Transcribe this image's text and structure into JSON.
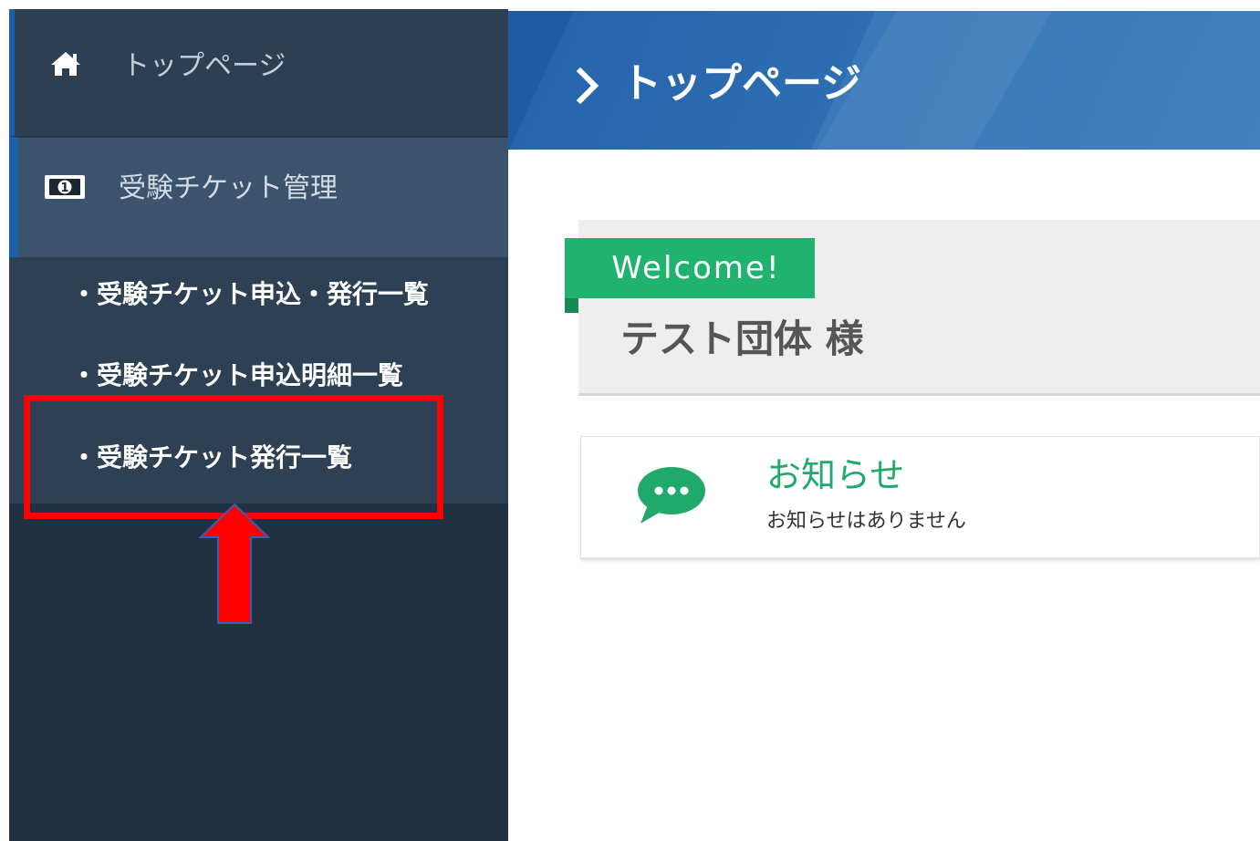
{
  "sidebar": {
    "home": {
      "label": "トップページ",
      "icon": "home-icon"
    },
    "group": {
      "label": "受験チケット管理",
      "icon": "ticket-icon"
    },
    "items": [
      {
        "label": "・受験チケット申込・発行一覧"
      },
      {
        "label": "・受験チケット申込明細一覧"
      },
      {
        "label": "・受験チケット発行一覧"
      }
    ]
  },
  "header": {
    "title": "トップページ",
    "icon": "chevron-right-icon"
  },
  "welcome": {
    "badge": "Welcome!",
    "name": "テスト団体 様"
  },
  "notice": {
    "icon": "chat-bubble-icon",
    "title": "お知らせ",
    "body": "お知らせはありません"
  },
  "annotation": {
    "box_color": "#ff0000",
    "arrow_color": "#ff0000"
  },
  "colors": {
    "sidebar_bg": "#223142",
    "header_blue": "#2d6db1",
    "accent_green": "#20b36f"
  }
}
